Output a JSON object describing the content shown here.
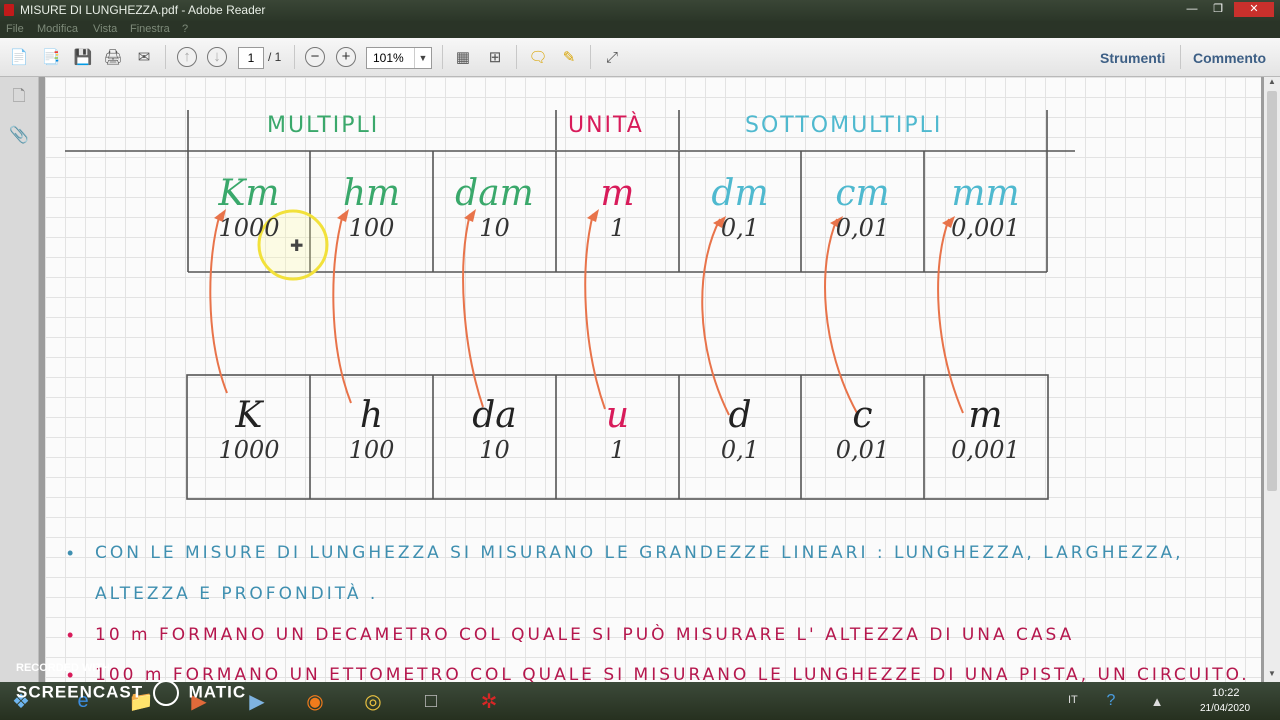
{
  "window": {
    "title": "MISURE DI LUNGHEZZA.pdf - Adobe Reader"
  },
  "menu": [
    "File",
    "Modifica",
    "Vista",
    "Finestra",
    "?"
  ],
  "toolbar": {
    "page_current": "1",
    "page_total": "/ 1",
    "zoom": "101%",
    "right_links": [
      "Strumenti",
      "Commento"
    ]
  },
  "document": {
    "headers": {
      "multipli": "MULTIPLI",
      "unita": "UNITÀ",
      "sottomultipli": "SOTTOMULTIPLI"
    },
    "units": [
      {
        "symbol": "Km",
        "value": "1000",
        "color": "#3aa86b"
      },
      {
        "symbol": "hm",
        "value": "100",
        "color": "#3aa86b"
      },
      {
        "symbol": "dam",
        "value": "10",
        "color": "#3aa86b"
      },
      {
        "symbol": "m",
        "value": "1",
        "color": "#d81b5a"
      },
      {
        "symbol": "dm",
        "value": "0,1",
        "color": "#4fb9cf"
      },
      {
        "symbol": "cm",
        "value": "0,01",
        "color": "#4fb9cf"
      },
      {
        "symbol": "mm",
        "value": "0,001",
        "color": "#4fb9cf"
      }
    ],
    "prefixes": [
      {
        "symbol": "K",
        "value": "1000",
        "color": "#222222"
      },
      {
        "symbol": "h",
        "value": "100",
        "color": "#222222"
      },
      {
        "symbol": "da",
        "value": "10",
        "color": "#222222"
      },
      {
        "symbol": "u",
        "value": "1",
        "color": "#d81b5a"
      },
      {
        "symbol": "d",
        "value": "0,1",
        "color": "#222222"
      },
      {
        "symbol": "c",
        "value": "0,01",
        "color": "#222222"
      },
      {
        "symbol": "m",
        "value": "0,001",
        "color": "#222222"
      }
    ],
    "notes": [
      "CON LE MISURE DI LUNGHEZZA SI MISURANO LE GRANDEZZE LINEARI : LUNGHEZZA, LARGHEZZA,",
      "ALTEZZA E PROFONDITÀ .",
      "10 m FORMANO UN DECAMETRO COL QUALE SI PUÒ MISURARE L' ALTEZZA DI UNA CASA",
      "100 m FORMANO UN ETTOMETRO COL QUALE SI MISURANO LE LUNGHEZZE DI UNA PISTA, UN CIRCUITO."
    ],
    "colors": {
      "green": "#3aa86b",
      "pink": "#d81b5a",
      "cyan": "#4fb9cf",
      "blue_note": "#3f8fb0",
      "arrow": "#e8734a"
    }
  },
  "watermark": {
    "line1": "RECORDED WITH",
    "line2": "SCREENCAST",
    "line3": "MATIC"
  },
  "taskbar": {
    "lang": "IT",
    "time": "10:22",
    "date": "21/04/2020"
  }
}
